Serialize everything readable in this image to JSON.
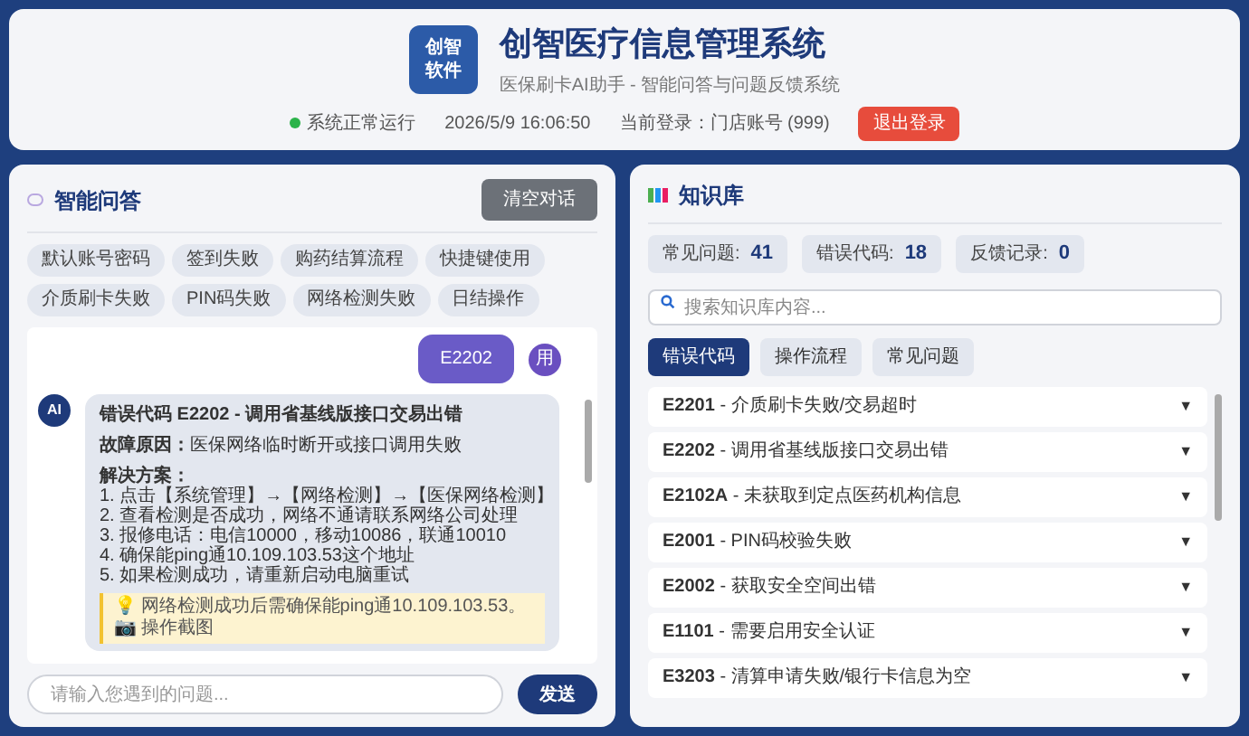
{
  "header": {
    "logo": [
      "创智",
      "软件"
    ],
    "title": "创智医疗信息管理系统",
    "subtitle": "医保刷卡AI助手 - 智能问答与问题反馈系统",
    "status": "系统正常运行",
    "datetime": "2026/5/9 16:06:50",
    "login": "当前登录：门店账号 (999)",
    "logout_button": "退出登录"
  },
  "chat": {
    "title": "智能问答",
    "clear_button": "清空对话",
    "quick_questions": [
      "默认账号密码",
      "签到失败",
      "购药结算流程",
      "快捷键使用",
      "介质刷卡失败",
      "PIN码失败",
      "网络检测失败",
      "日结操作"
    ],
    "messages": [
      {
        "kind": "user",
        "avatar": "用",
        "text": "E2202"
      },
      {
        "kind": "ai",
        "avatar": "AI",
        "title": "错误代码 E2202 - 调用省基线版接口交易出错",
        "cause_label": "故障原因：",
        "cause": "医保网络临时断开或接口调用失败",
        "solution_label": "解决方案：",
        "steps": [
          "1. 点击【系统管理】→【网络检测】→【医保网络检测】",
          "2. 查看检测是否成功，网络不通请联系网络公司处理",
          "3. 报修电话：电信10000，移动10086，联通10010",
          "4. 确保能ping通10.109.103.53这个地址",
          "5. 如果检测成功，请重新启动电脑重试"
        ],
        "tip": "💡 网络检测成功后需确保能ping通10.109.103.53。 📷 操作截图"
      }
    ],
    "input_placeholder": "请输入您遇到的问题...",
    "send_button": "发送"
  },
  "knowledge": {
    "title": "知识库",
    "stats": [
      {
        "label": "常见问题:",
        "value": "41"
      },
      {
        "label": "错误代码:",
        "value": "18"
      },
      {
        "label": "反馈记录:",
        "value": "0"
      }
    ],
    "search_placeholder": "搜索知识库内容...",
    "tabs": [
      {
        "label": "错误代码",
        "selected": true
      },
      {
        "label": "操作流程",
        "selected": false
      },
      {
        "label": "常见问题",
        "selected": false
      }
    ],
    "items": [
      {
        "code": "E2201",
        "text": " - 介质刷卡失败/交易超时",
        "arrow": "▼"
      },
      {
        "code": "E2202",
        "text": " - 调用省基线版接口交易出错",
        "arrow": "▼"
      },
      {
        "code": "E2102A",
        "text": " - 未获取到定点医药机构信息",
        "arrow": "▼"
      },
      {
        "code": "E2001",
        "text": " - PIN码校验失败",
        "arrow": "▼"
      },
      {
        "code": "E2002",
        "text": " - 获取安全空间出错",
        "arrow": "▼"
      },
      {
        "code": "E1101",
        "text": " - 需要启用安全认证",
        "arrow": "▼"
      },
      {
        "code": "E3203",
        "text": " - 清算申请失败/银行卡信息为空",
        "arrow": "▼"
      }
    ]
  }
}
